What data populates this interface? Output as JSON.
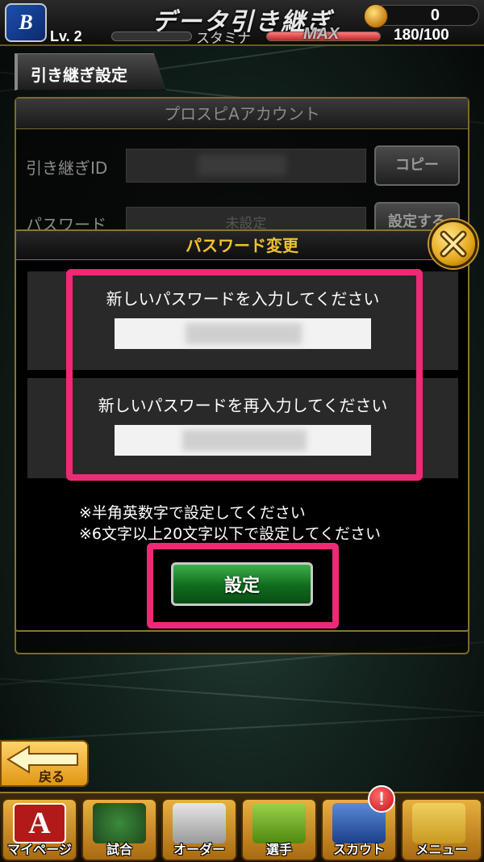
{
  "header": {
    "app_logo_text": "B",
    "title": "データ引き継ぎ",
    "currency_value": "0",
    "level": "Lv. 2",
    "stamina_label": "スタミナ",
    "stamina_max": "MAX",
    "stamina_count": "180/100",
    "stamina_fraction": 1.0
  },
  "section_tab": {
    "label": "引き継ぎ設定"
  },
  "account": {
    "header": "プロスピAアカウント",
    "id_label": "引き継ぎID",
    "copy_button": "コピー",
    "password_label": "パスワード",
    "password_value": "未設定",
    "set_button": "設定する"
  },
  "modal": {
    "title": "パスワード変更",
    "new_password_label": "新しいパスワードを入力してください",
    "confirm_password_label": "新しいパスワードを再入力してください",
    "note_1": "※半角英数字で設定してください",
    "note_2": "※6文字以上20文字以下で設定してください",
    "submit_button": "設定"
  },
  "back_button": {
    "label": "戻る"
  },
  "bottom_nav": {
    "items": [
      {
        "label": "マイページ",
        "icon": "A"
      },
      {
        "label": "試合",
        "icon": "stadium-icon"
      },
      {
        "label": "オーダー",
        "icon": "field-icon"
      },
      {
        "label": "選手",
        "icon": "player-icon"
      },
      {
        "label": "スカウト",
        "icon": "card-icon"
      },
      {
        "label": "メニュー",
        "icon": "menu-icon"
      }
    ],
    "alert_badge": "!"
  },
  "colors": {
    "highlight": "#ee2a74",
    "gold_border": "#8a7530",
    "modal_title": "#f1c232",
    "submit_green": "#0f6b1e"
  }
}
